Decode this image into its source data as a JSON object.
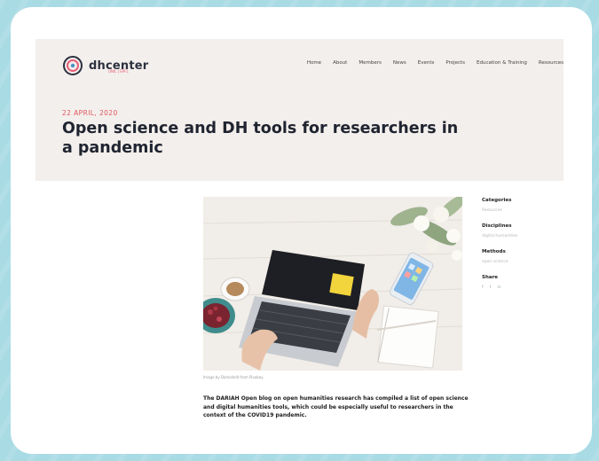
{
  "site": {
    "logo_text": "dhcenter",
    "logo_sub": "UNIL | EPFL"
  },
  "nav": {
    "items": [
      "Home",
      "About",
      "Members",
      "News",
      "Events",
      "Projects",
      "Education & Training",
      "Resources"
    ]
  },
  "article": {
    "date": "22 APRIL, 2020",
    "title": "Open science and DH tools for researchers in a pandemic",
    "image_caption": "Image by Darkollеld from Pixabay",
    "intro": "The DARIAH Open blog on open humanities research has compiled a list of open science and digital humanities tools, which could be especially useful to researchers in the context of the COVID19 pandemic."
  },
  "sidebar": {
    "categories_label": "Categories",
    "categories_value": "Resources",
    "disciplines_label": "Disciplines",
    "disciplines_value": "digital humanities",
    "methods_label": "Methods",
    "methods_value": "open science",
    "share_label": "Share",
    "share_icons": [
      "f",
      "t",
      "in"
    ]
  },
  "colors": {
    "background": "#a9dbe4",
    "hero": "#f3efec",
    "date_accent": "#e0565f",
    "title": "#1f2430"
  }
}
